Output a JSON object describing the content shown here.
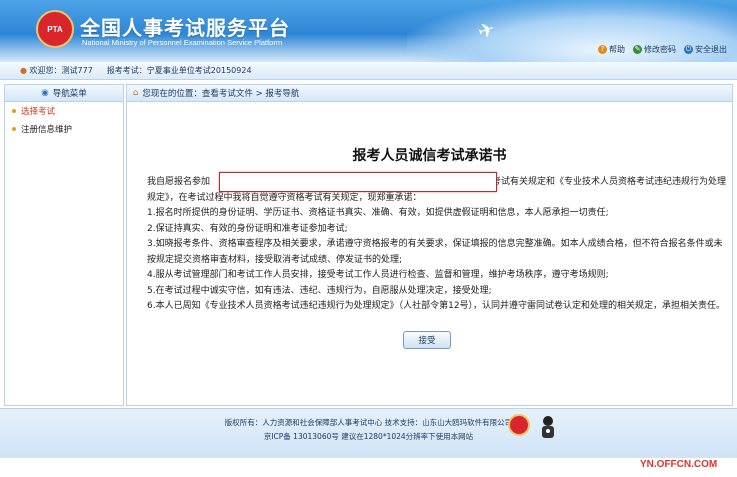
{
  "header": {
    "title": "全国人事考试服务平台",
    "subtitle": "National Ministry of Personnel Examination Service Platform",
    "logo_text": "PTA",
    "links": [
      {
        "label": "帮助",
        "icon": "help-icon"
      },
      {
        "label": "修改密码",
        "icon": "key-icon"
      },
      {
        "label": "安全退出",
        "icon": "exit-icon"
      }
    ]
  },
  "infobar": {
    "welcome": "欢迎您：测试777",
    "exam": "报考考试：宁夏事业单位考试20150924"
  },
  "sidebar": {
    "title": "导航菜单",
    "items": [
      {
        "label": "选择考试",
        "active": true
      },
      {
        "label": "注册信息维护",
        "active": false
      }
    ]
  },
  "breadcrumb": "您现在的位置：查看考试文件 > 报考导航",
  "document": {
    "title": "报考人员诚信考试承诺书",
    "intro_start": "我自愿报名参加",
    "intro_end": "考试有关规定和《专业技术人员资格考试违纪违规行为处理规定》，在考试过程中我将自觉遵守资格考试有关规定，现郑重承诺：",
    "items": [
      "1.报名时所提供的身份证明、学历证书、资格证书真实、准确、有效，如提供虚假证明和信息，本人愿承担一切责任;",
      "2.保证持真实、有效的身份证明和准考证参加考试;",
      "3.如晓报考条件、资格审查程序及相关要求，承诺遵守资格报考的有关要求，保证填报的信息完整准确。如本人成绩合格，但不符合报名条件或未按规定提交资格审查材料，接受取消考试成绩、停发证书的处理;",
      "4.服从考试管理部门和考试工作人员安排，接受考试工作人员进行检查、监督和管理，维护考场秩序，遵守考场规则;",
      "5.在考试过程中诚实守信，如有违法、违纪、违规行为，自愿服从处理决定，接受处理;",
      "6.本人已周知《专业技术人员资格考试违纪违规行为处理规定》（人社部令第12号），认同并遵守雷同试卷认定和处理的相关规定，承担相关责任。"
    ],
    "accept_label": "接受"
  },
  "footer": {
    "line1": "版权所有：人力资源和社会保障部人事考试中心  技术支持：山东山大鸥玛软件有限公司",
    "line2": "京ICP备 13013060号  建议在1280*1024分辨率下使用本网站"
  },
  "watermark": "YN.OFFCN.COM",
  "colors": {
    "accent": "#2e86d6",
    "active_menu": "#d23c1e",
    "input_border": "#b3302d"
  }
}
